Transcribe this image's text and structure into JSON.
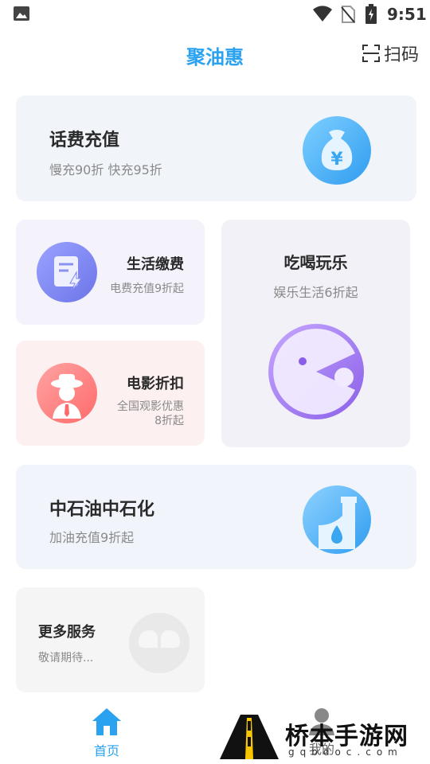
{
  "status_bar": {
    "time": "9:51",
    "icons": [
      "image-icon",
      "wifi-icon",
      "no-sim-icon",
      "battery-icon"
    ]
  },
  "header": {
    "title": "聚油惠",
    "scan_label": "扫码"
  },
  "cards": {
    "phone": {
      "title": "话费充值",
      "subtitle": "慢充90折 快充95折",
      "icon": "money-bag-icon"
    },
    "life": {
      "title": "生活缴费",
      "subtitle": "电费充值9折起",
      "icon": "bill-icon"
    },
    "movie": {
      "title": "电影折扣",
      "subtitle_line1": "全国观影优惠",
      "subtitle_line2": "8折起",
      "icon": "movie-person-icon"
    },
    "fun": {
      "title": "吃喝玩乐",
      "subtitle": "娱乐生活6折起",
      "icon": "pacman-icon"
    },
    "oil": {
      "title": "中石油中石化",
      "subtitle": "加油充值9折起",
      "icon": "fuel-drop-icon"
    },
    "more": {
      "title": "更多服务",
      "subtitle": "敬请期待...",
      "icon": "more-services-icon"
    }
  },
  "bottom_nav": {
    "home_label": "首页",
    "me_label": "我的"
  },
  "watermark": {
    "text": "桥本手游网",
    "url": "gqbdoc.com"
  },
  "colors": {
    "accent": "#2aa2f0",
    "phone_icon": "#4fb4f0",
    "life_icon": "#7e86f0",
    "movie_icon": "#ff7a7a",
    "fun_icon": "#a57bf0",
    "oil_icon": "#4cb2f2"
  }
}
